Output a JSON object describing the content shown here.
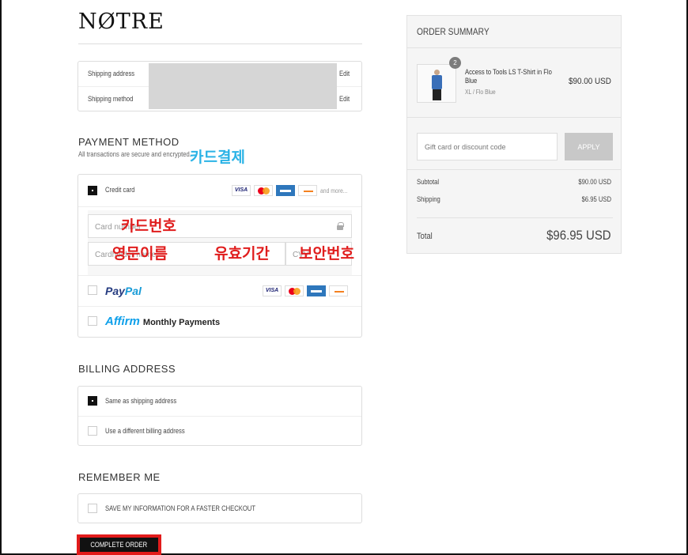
{
  "brand": {
    "logo": "NØTRE"
  },
  "shipping": {
    "address_label": "Shipping address",
    "method_label": "Shipping method",
    "edit_label": "Edit"
  },
  "payment": {
    "title": "PAYMENT METHOD",
    "subtitle": "All transactions are secure and encrypted.",
    "credit_card_label": "Credit card",
    "and_more": "and more...",
    "card_number_placeholder": "Card number",
    "name_placeholder": "Cardholder name",
    "cvv_placeholder": "CVV",
    "paypal": {
      "part1": "Pay",
      "part2": "Pal"
    },
    "affirm": {
      "logo": "Affirm",
      "label": "Monthly Payments"
    },
    "brands": {
      "visa": "VISA"
    }
  },
  "annotations": {
    "card_payment": "카드결제",
    "card_number": "카드번호",
    "english_name": "영문이름",
    "expiry": "유효기간",
    "security_code": "보안번호"
  },
  "billing": {
    "title": "BILLING ADDRESS",
    "same_label": "Same as shipping address",
    "different_label": "Use a different billing address"
  },
  "remember": {
    "title": "REMEMBER ME",
    "save_label": "SAVE MY INFORMATION FOR A FASTER CHECKOUT"
  },
  "actions": {
    "complete_order": "COMPLETE ORDER"
  },
  "summary": {
    "title": "ORDER SUMMARY",
    "item": {
      "quantity": "2",
      "name": "Access to Tools LS T-Shirt in Flo Blue",
      "variant": "XL / Flo Blue",
      "price": "$90.00 USD"
    },
    "discount_placeholder": "Gift card or discount code",
    "apply_label": "APPLY",
    "subtotal_label": "Subtotal",
    "subtotal_value": "$90.00 USD",
    "shipping_label": "Shipping",
    "shipping_value": "$6.95 USD",
    "total_label": "Total",
    "total_value": "$96.95 USD"
  },
  "colors": {
    "annotation_cyan": "#2bb3e6",
    "annotation_red": "#e01d1d",
    "highlight_border": "#e21b1b"
  }
}
